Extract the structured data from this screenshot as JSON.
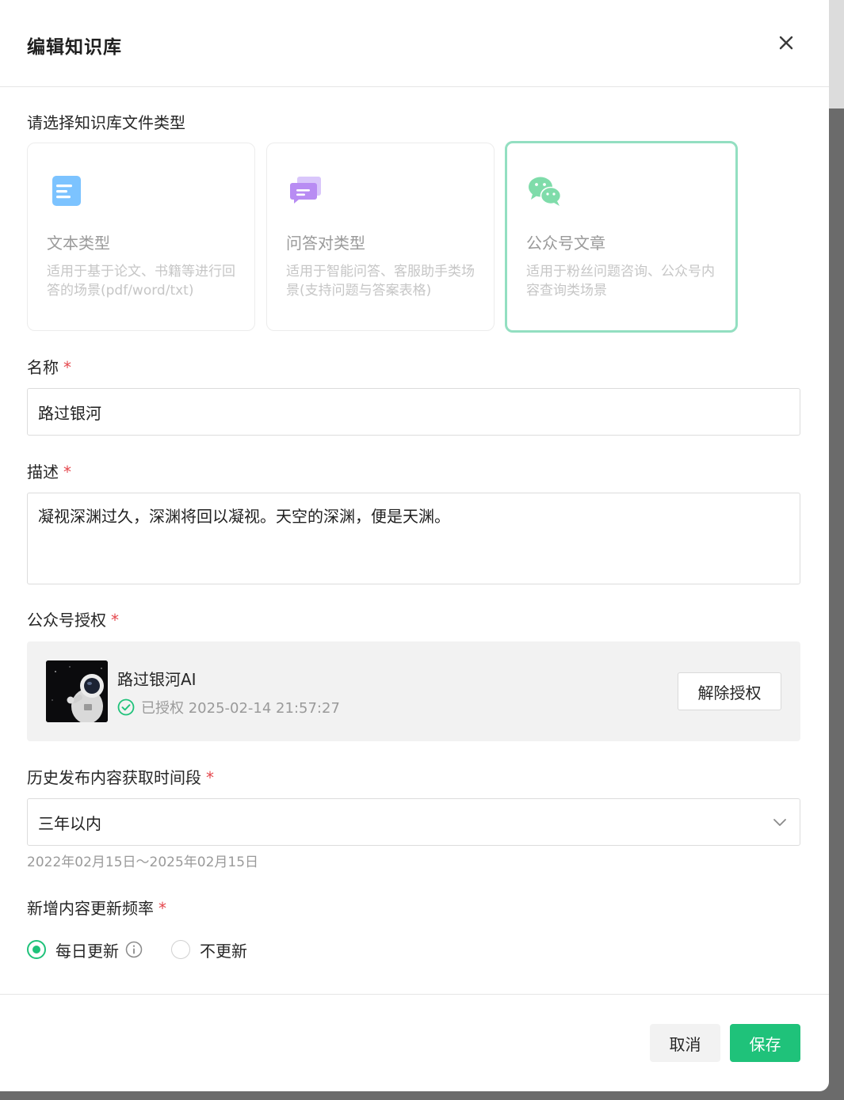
{
  "dialog": {
    "title": "编辑知识库"
  },
  "type_section": {
    "label": "请选择知识库文件类型",
    "cards": [
      {
        "icon": "text-doc-icon",
        "title": "文本类型",
        "desc": "适用于基于论文、书籍等进行回答的场景(pdf/word/txt)",
        "selected": false
      },
      {
        "icon": "qa-chat-icon",
        "title": "问答对类型",
        "desc": "适用于智能问答、客服助手类场景(支持问题与答案表格)",
        "selected": false
      },
      {
        "icon": "wechat-icon",
        "title": "公众号文章",
        "desc": "适用于粉丝问题咨询、公众号内容查询类场景",
        "selected": true
      }
    ]
  },
  "name_field": {
    "label": "名称",
    "value": "路过银河"
  },
  "desc_field": {
    "label": "描述",
    "value": "凝视深渊过久，深渊将回以凝视。天空的深渊，便是天渊。"
  },
  "auth": {
    "label": "公众号授权",
    "account_name": "路过银河AI",
    "status": "已授权 2025-02-14 21:57:27",
    "revoke_label": "解除授权"
  },
  "history": {
    "label": "历史发布内容获取时间段",
    "selected": "三年以内",
    "range_hint": "2022年02月15日～2025年02月15日"
  },
  "frequency": {
    "label": "新增内容更新频率",
    "options": [
      {
        "label": "每日更新",
        "checked": true
      },
      {
        "label": "不更新",
        "checked": false
      }
    ]
  },
  "footer": {
    "cancel_label": "取消",
    "save_label": "保存"
  },
  "colors": {
    "accent": "#1fc27a",
    "selected_border": "#93dfc1",
    "required": "#e5484d"
  }
}
